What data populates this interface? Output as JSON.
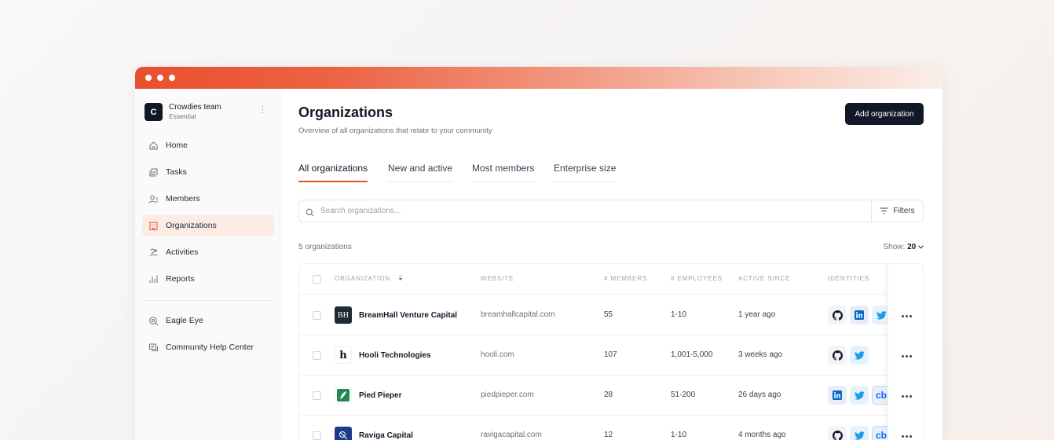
{
  "sidebar": {
    "team": {
      "logo": "C",
      "name": "Crowdies team",
      "plan": "Essential",
      "more_icon": "vertical-dots-icon"
    },
    "items": [
      {
        "label": "Home",
        "icon": "home-icon"
      },
      {
        "label": "Tasks",
        "icon": "tasks-icon"
      },
      {
        "label": "Members",
        "icon": "members-icon"
      },
      {
        "label": "Organizations",
        "icon": "organizations-icon",
        "active": true
      },
      {
        "label": "Activities",
        "icon": "activities-icon"
      },
      {
        "label": "Reports",
        "icon": "reports-icon"
      }
    ],
    "secondary_items": [
      {
        "label": "Eagle Eye",
        "icon": "eagle-eye-icon"
      },
      {
        "label": "Community Help Center",
        "icon": "help-center-icon"
      }
    ]
  },
  "header": {
    "title": "Organizations",
    "subtitle": "Overview of all organizations that relate to your community",
    "add_button": "Add organization"
  },
  "tabs": [
    {
      "label": "All organizations",
      "active": true
    },
    {
      "label": "New and active"
    },
    {
      "label": "Most members"
    },
    {
      "label": "Enterprise size"
    }
  ],
  "search": {
    "placeholder": "Search organizations...",
    "value": ""
  },
  "filters": {
    "label": "Filters"
  },
  "summary": {
    "count": "5 organizations",
    "show_prefix": "Show:",
    "show_value": "20"
  },
  "table": {
    "columns": [
      "Organization",
      "Website",
      "# Members",
      "# Employees",
      "Active since",
      "Identities"
    ],
    "rows": [
      {
        "name": "BreamHall Venture Capital",
        "logo": "BH",
        "website": "breamhallcapital.com",
        "members": "55",
        "employees": "1-10",
        "active_since": "1 year ago",
        "identities": [
          "github",
          "linkedin",
          "twitter"
        ]
      },
      {
        "name": "Hooli Technologies",
        "logo": "h",
        "website": "hooli.com",
        "members": "107",
        "employees": "1,001-5,000",
        "active_since": "3 weeks ago",
        "identities": [
          "github",
          "twitter"
        ]
      },
      {
        "name": "Pied Pieper",
        "logo": "pied-piper-logo",
        "website": "piedpieper.com",
        "members": "28",
        "employees": "51-200",
        "active_since": "26 days ago",
        "identities": [
          "linkedin",
          "twitter",
          "crunchbase"
        ]
      },
      {
        "name": "Raviga Capital",
        "logo": "raviga-logo",
        "website": "ravigacapital.com",
        "members": "12",
        "employees": "1-10",
        "active_since": "4 months ago",
        "identities": [
          "github",
          "twitter",
          "crunchbase"
        ]
      }
    ]
  },
  "crunchbase_label": "cb",
  "colors": {
    "accent": "#e94f2e",
    "primary_dark": "#111827",
    "active_nav_bg": "#fdece6"
  }
}
